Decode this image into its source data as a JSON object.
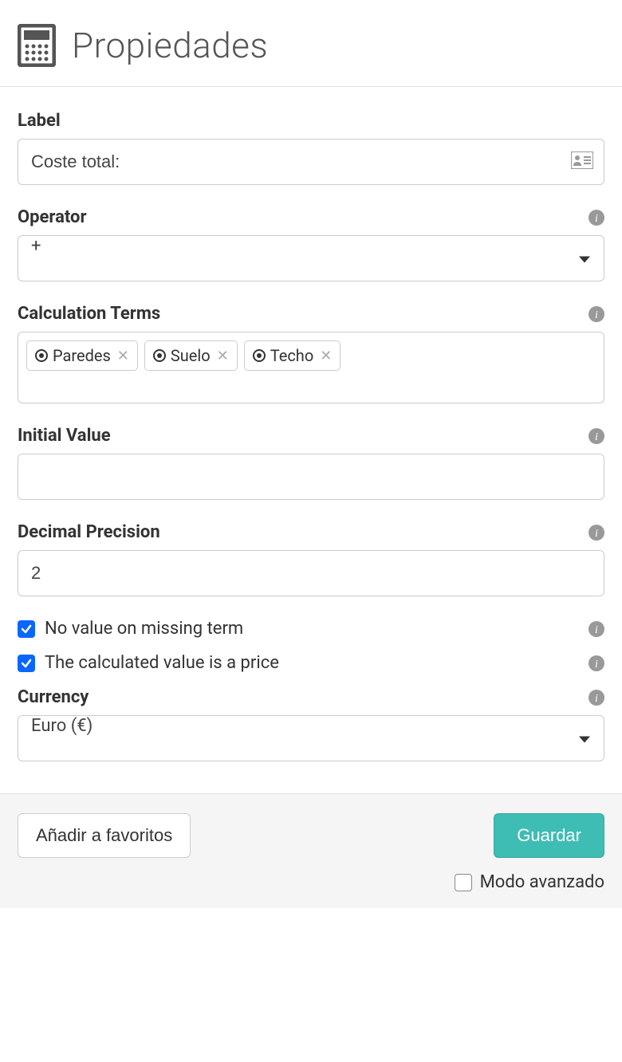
{
  "header": {
    "title": "Propiedades"
  },
  "fields": {
    "label": {
      "label": "Label",
      "value": "Coste total:"
    },
    "operator": {
      "label": "Operator",
      "value": "+"
    },
    "calculation_terms": {
      "label": "Calculation Terms",
      "tags": [
        "Paredes",
        "Suelo",
        "Techo"
      ]
    },
    "initial_value": {
      "label": "Initial Value",
      "value": ""
    },
    "decimal_precision": {
      "label": "Decimal Precision",
      "value": "2"
    },
    "no_value_missing": {
      "label": "No value on missing term",
      "checked": true
    },
    "value_is_price": {
      "label": "The calculated value is a price",
      "checked": true
    },
    "currency": {
      "label": "Currency",
      "value": "Euro (€)"
    }
  },
  "footer": {
    "add_favorites": "Añadir a favoritos",
    "save": "Guardar",
    "advanced_mode": "Modo avanzado",
    "advanced_mode_checked": false
  }
}
